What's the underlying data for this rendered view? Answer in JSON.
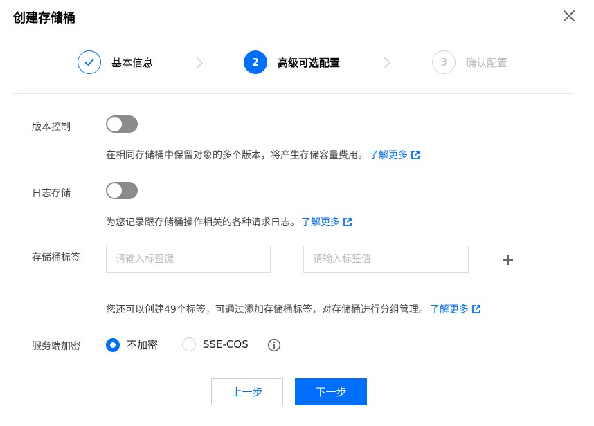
{
  "dialog": {
    "title": "创建存储桶"
  },
  "steps": [
    {
      "number": "",
      "label": "基本信息",
      "state": "done"
    },
    {
      "number": "2",
      "label": "高级可选配置",
      "state": "active"
    },
    {
      "number": "3",
      "label": "确认配置",
      "state": "pending"
    }
  ],
  "versioning": {
    "label": "版本控制",
    "enabled": false,
    "description": "在相同存储桶中保留对象的多个版本，将产生存储容量费用。",
    "link": "了解更多"
  },
  "logging": {
    "label": "日志存储",
    "enabled": false,
    "description": "为您记录跟存储桶操作相关的各种请求日志。",
    "link": "了解更多"
  },
  "tags": {
    "label": "存储桶标签",
    "key_placeholder": "请输入标签键",
    "key_value": "",
    "value_placeholder": "请输入标签值",
    "value_value": "",
    "hint": "您还可以创建49个标签，可通过添加存储桶标签，对存储桶进行分组管理。",
    "link": "了解更多"
  },
  "encryption": {
    "label": "服务端加密",
    "options": [
      {
        "label": "不加密",
        "checked": true
      },
      {
        "label": "SSE-COS",
        "checked": false
      }
    ]
  },
  "footer": {
    "prev_label": "上一步",
    "next_label": "下一步"
  },
  "colors": {
    "accent": "#006eff",
    "switch_off": "#8b8b8b"
  }
}
